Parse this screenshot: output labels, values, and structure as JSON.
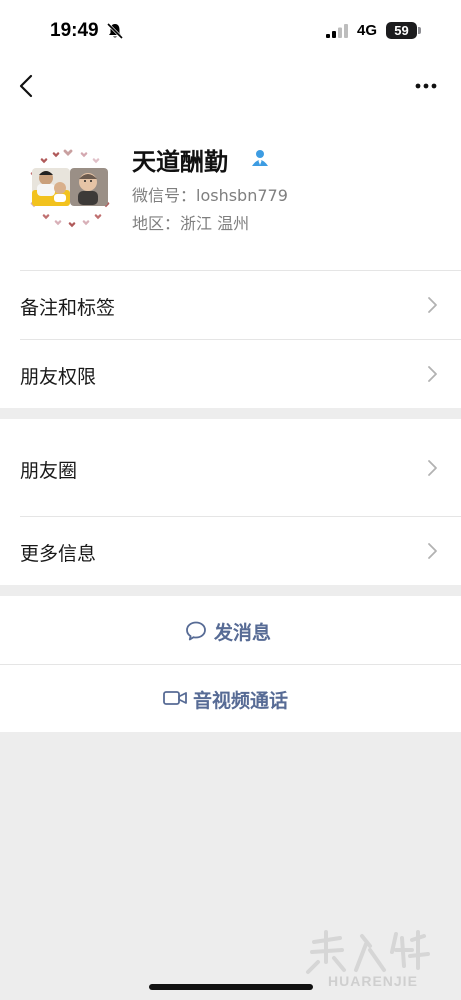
{
  "status_bar": {
    "time": "19:49",
    "network": "4G",
    "battery": "59"
  },
  "profile": {
    "name": "天道酬勤",
    "wechat_id": "微信号：loshsbn779",
    "region": "地区：浙江 温州"
  },
  "menu": {
    "remarks_tags": "备注和标签",
    "friend_permissions": "朋友权限",
    "moments": "朋友圈",
    "more_info": "更多信息"
  },
  "actions": {
    "send_message": "发消息",
    "video_call": "音视频通话"
  },
  "watermark": {
    "text": "HUARENJIE"
  },
  "colors": {
    "link_blue": "#576b95",
    "background": "#ededed",
    "divider": "#e5e5e5",
    "contact_icon": "#3d9ce2"
  }
}
